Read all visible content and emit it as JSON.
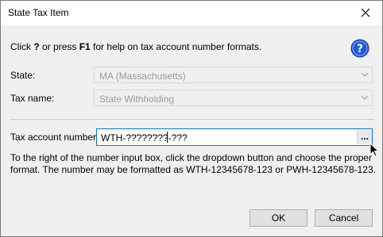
{
  "window": {
    "title": "State Tax Item"
  },
  "help": {
    "prefix": "Click ",
    "q": "?",
    "mid": " or press ",
    "f1": "F1",
    "suffix": " for help on tax account number formats."
  },
  "state": {
    "label": "State:",
    "value": "MA (Massachusetts)"
  },
  "tax_name": {
    "label": "Tax name:",
    "value": "State Withholding"
  },
  "account": {
    "label": "Tax account number:",
    "value": "WTH-????????-???",
    "button_label": "..."
  },
  "description": "To the right of the number input box, click the dropdown button and choose the proper format. The number may be formatted as WTH-12345678-123 or PWH-12345678-123.",
  "buttons": {
    "ok": "OK",
    "cancel": "Cancel"
  },
  "icons": {
    "close": "close-icon",
    "help": "help-icon",
    "chevron": "chevron-down-icon",
    "cursor": "mouse-pointer-icon"
  },
  "colors": {
    "focus_border": "#0078d7",
    "help_blue": "#1e5bd8"
  }
}
